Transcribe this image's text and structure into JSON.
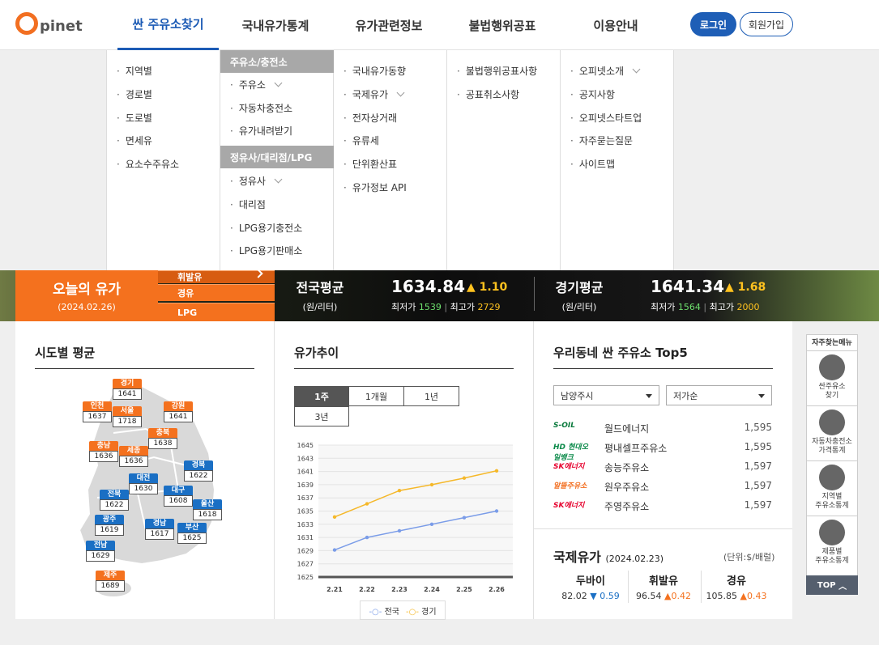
{
  "header": {
    "logo_text": "pinet",
    "nav": [
      "싼 주유소찾기",
      "국내유가통계",
      "유가관련정보",
      "불법행위공표",
      "이용안내"
    ],
    "login": "로그인",
    "join": "회원가입"
  },
  "mega": {
    "col1": [
      "지역별",
      "경로별",
      "도로별",
      "면세유",
      "요소수주유소"
    ],
    "col2_group1": "주유소/충전소",
    "col2_items1": [
      "주유소",
      "자동차충전소",
      "유가내려받기"
    ],
    "col2_group2": "정유사/대리점/LPG",
    "col2_items2": [
      "정유사",
      "대리점",
      "LPG용기충전소",
      "LPG용기판매소"
    ],
    "col3": [
      "국내유가동향",
      "국제유가",
      "전자상거래",
      "유류세",
      "단위환산표",
      "유가정보 API"
    ],
    "col4": [
      "불법행위공표사항",
      "공표취소사항"
    ],
    "col5": [
      "오피넷소개",
      "공지사항",
      "오피넷스타트업",
      "자주묻는질문",
      "사이트맵"
    ]
  },
  "today": {
    "title": "오늘의 유가",
    "date": "(2024.02.26)",
    "fuel_tabs": [
      "휘발유",
      "경유",
      "LPG"
    ]
  },
  "national": {
    "label": "전국평균",
    "unit": "(원/리터)",
    "value": "1634.84",
    "change": "▲ 1.10",
    "min_label": "최저가",
    "min": "1539",
    "max_label": "최고가",
    "max": "2729"
  },
  "gyeonggi": {
    "label": "경기평균",
    "unit": "(원/리터)",
    "value": "1641.34",
    "change": "▲ 1.68",
    "min_label": "최저가",
    "min": "1564",
    "max_label": "최고가",
    "max": "2000"
  },
  "sido": {
    "title": "시도별 평균",
    "regions": [
      {
        "name": "경기",
        "value": "1641",
        "color": "orange"
      },
      {
        "name": "인천",
        "value": "1637",
        "color": "orange"
      },
      {
        "name": "서울",
        "value": "1718",
        "color": "orange"
      },
      {
        "name": "강원",
        "value": "1641",
        "color": "orange"
      },
      {
        "name": "충북",
        "value": "1638",
        "color": "orange"
      },
      {
        "name": "충남",
        "value": "1636",
        "color": "orange"
      },
      {
        "name": "세종",
        "value": "1636",
        "color": "orange"
      },
      {
        "name": "경북",
        "value": "1622",
        "color": "blue"
      },
      {
        "name": "대전",
        "value": "1630",
        "color": "blue"
      },
      {
        "name": "전북",
        "value": "1622",
        "color": "blue"
      },
      {
        "name": "대구",
        "value": "1608",
        "color": "blue"
      },
      {
        "name": "울산",
        "value": "1618",
        "color": "blue"
      },
      {
        "name": "광주",
        "value": "1619",
        "color": "blue"
      },
      {
        "name": "경남",
        "value": "1617",
        "color": "blue"
      },
      {
        "name": "부산",
        "value": "1625",
        "color": "blue"
      },
      {
        "name": "전남",
        "value": "1629",
        "color": "blue"
      },
      {
        "name": "제주",
        "value": "1689",
        "color": "orange"
      }
    ]
  },
  "trend": {
    "title": "유가추이",
    "tabs": [
      "1주",
      "1개월",
      "1년",
      "3년"
    ]
  },
  "chart_data": {
    "type": "line",
    "x": [
      "2.21",
      "2.22",
      "2.23",
      "2.24",
      "2.25",
      "2.26"
    ],
    "series": [
      {
        "name": "전국",
        "values": [
          1629.1,
          1631.0,
          1632.0,
          1633.0,
          1634.0,
          1635.0
        ],
        "color": "#7a9ce8"
      },
      {
        "name": "경기",
        "values": [
          1634.1,
          1636.1,
          1638.1,
          1639.0,
          1640.0,
          1641.1
        ],
        "color": "#f5b82a"
      }
    ],
    "yticks": [
      1625,
      1627,
      1629,
      1631,
      1633,
      1635,
      1637,
      1639,
      1641,
      1643,
      1645
    ],
    "ylim": [
      1625,
      1645
    ],
    "grid": true,
    "legend": "bottom"
  },
  "top5": {
    "title": "우리동네 싼 주유소 Top5",
    "region": "남양주시",
    "sort": "저가순",
    "stations": [
      {
        "brand": "S-OIL",
        "name": "월드에너지",
        "price": "1,595"
      },
      {
        "brand": "HD 현대오일뱅크",
        "name": "평내셀프주유소",
        "price": "1,595"
      },
      {
        "brand": "SK에너지",
        "name": "송능주유소",
        "price": "1,597"
      },
      {
        "brand": "알뜰주유소",
        "name": "원우주유소",
        "price": "1,597"
      },
      {
        "brand": "SK에너지",
        "name": "주영주유소",
        "price": "1,597"
      }
    ]
  },
  "intl": {
    "title": "국제유가",
    "date": "(2024.02.23)",
    "unit": "(단위:$/배럴)",
    "items": [
      {
        "name": "두바이",
        "value": "82.02",
        "change": "▼ 0.59"
      },
      {
        "name": "휘발유",
        "value": "96.54",
        "change": "▲0.42"
      },
      {
        "name": "경유",
        "value": "105.85",
        "change": "▲0.43"
      }
    ]
  },
  "quick": {
    "title": "자주찾는메뉴",
    "items": [
      "싼주유소\n찾기",
      "자동차충전소\n가격통계",
      "지역별\n주유소통계",
      "제품별\n주유소통계"
    ],
    "top": "TOP"
  }
}
